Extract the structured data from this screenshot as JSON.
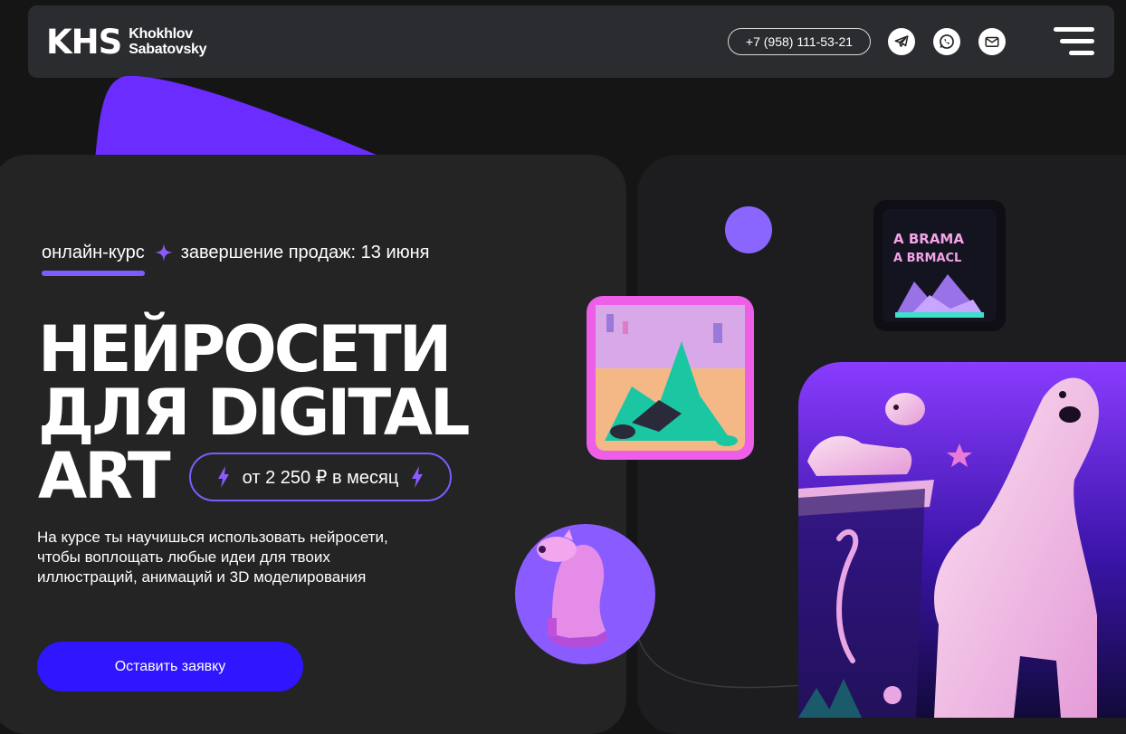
{
  "header": {
    "logo_mark": "KHS",
    "logo_line1": "Khokhlov",
    "logo_line2": "Sabatovsky",
    "phone": "+7 (958) 111-53-21",
    "social": [
      "telegram-icon",
      "whatsapp-icon",
      "mail-icon"
    ]
  },
  "hero": {
    "tag_online": "онлайн-курс",
    "tag_sales_end": "завершение продаж:  13 июня",
    "title_line1": "НЕЙРОСЕТИ",
    "title_line2": "ДЛЯ DIGITAL",
    "title_line3": "ART",
    "price": "от 2 250 ₽ в месяц",
    "description": "На курсе ты научишься использовать нейросети, чтобы воплощать любые идеи для твоих иллюстраций, анимаций и 3D моделирования",
    "cta": "Оставить заявку"
  },
  "poster": {
    "line1": "A BRAMA",
    "line2": "A BRMACL"
  },
  "colors": {
    "accent_purple": "#7c5cff",
    "cta_blue": "#2f16ff",
    "background": "#151515",
    "header_bg": "#2b2c30",
    "card_bg": "#242424"
  }
}
